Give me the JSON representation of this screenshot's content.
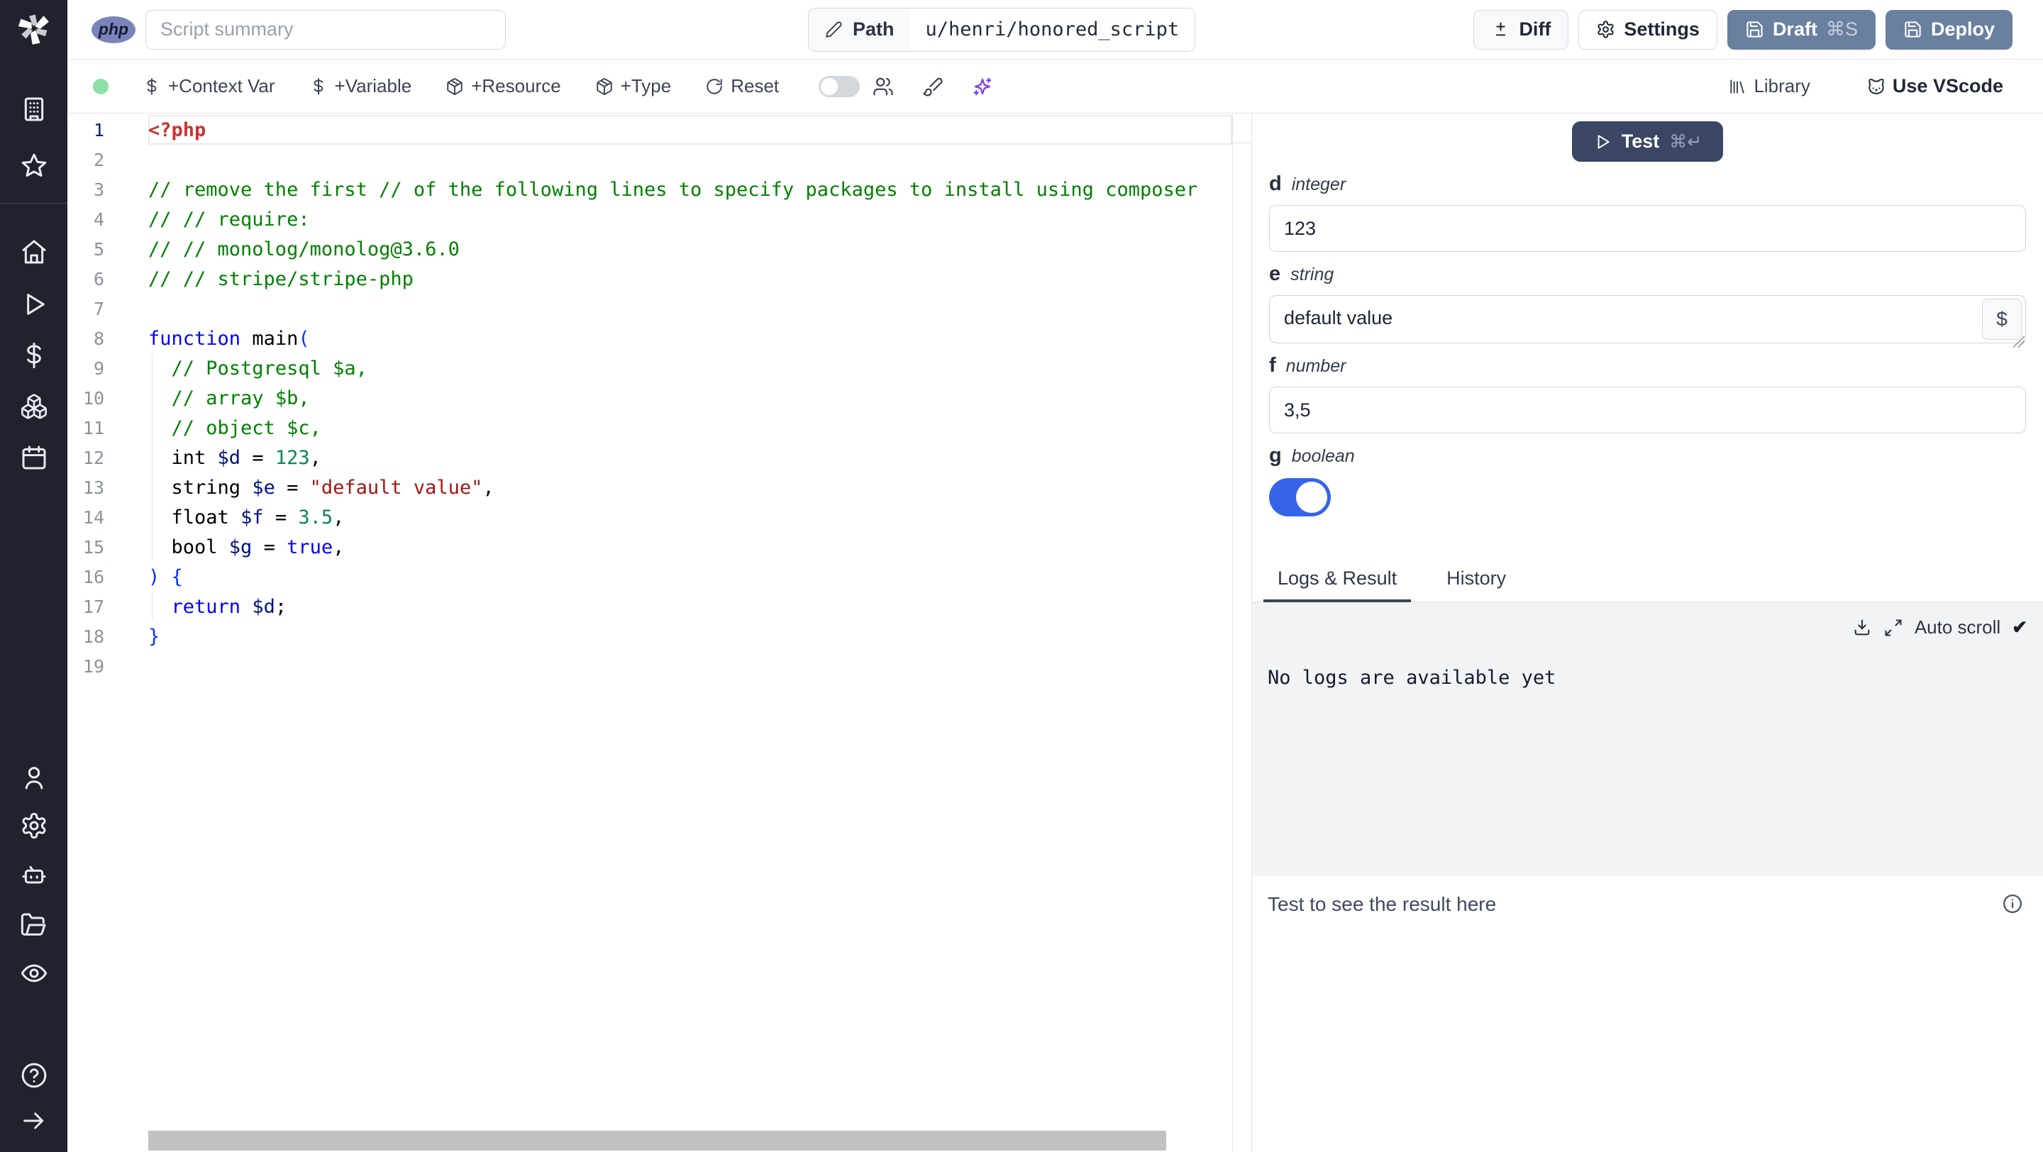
{
  "topbar": {
    "lang_badge": "php",
    "summary_placeholder": "Script summary",
    "path_label": "Path",
    "path_value": "u/henri/honored_script",
    "diff_label": "Diff",
    "settings_label": "Settings",
    "draft_label": "Draft",
    "draft_shortcut": "⌘S",
    "deploy_label": "Deploy"
  },
  "toolbar": {
    "add_context_var": "+Context Var",
    "add_variable": "+Variable",
    "add_resource": "+Resource",
    "add_type": "+Type",
    "reset_label": "Reset",
    "library_label": "Library",
    "vscode_label": "Use VScode"
  },
  "icons": {
    "windmill-logo-icon": "white pinwheel",
    "pencil-icon": "✎",
    "diff-icon": "±",
    "gear-icon": "⚙",
    "save-icon": "💾",
    "dollar-icon": "$",
    "package-icon": "box",
    "reset-icon": "↻",
    "users-icon": "people",
    "brush-icon": "paintbrush",
    "sparkles-icon": "✦ ai",
    "library-icon": "|||\\",
    "cat-icon": "vscode cat",
    "play-icon": "▷",
    "download-icon": "⤓",
    "expand-icon": "⤢",
    "check-icon": "✔",
    "info-icon": "ⓘ"
  },
  "sidebar": {
    "icons": [
      "windmill-logo",
      "building",
      "star",
      "home",
      "play",
      "dollar-sign",
      "boxes",
      "calendar",
      "user",
      "settings-gear",
      "bot",
      "folder-open",
      "eye",
      "help-circle",
      "arrow-right"
    ]
  },
  "editor": {
    "language": "php",
    "lines": [
      {
        "n": 1,
        "active": true,
        "tokens": [
          [
            "<?php",
            "tag"
          ]
        ]
      },
      {
        "n": 2,
        "tokens": []
      },
      {
        "n": 3,
        "tokens": [
          [
            "// remove the first // of the following lines to specify packages to install using composer",
            "comment"
          ]
        ]
      },
      {
        "n": 4,
        "tokens": [
          [
            "// // require:",
            "comment"
          ]
        ]
      },
      {
        "n": 5,
        "tokens": [
          [
            "// // monolog/monolog@3.6.0",
            "comment"
          ]
        ]
      },
      {
        "n": 6,
        "tokens": [
          [
            "// // stripe/stripe-php",
            "comment"
          ]
        ]
      },
      {
        "n": 7,
        "tokens": []
      },
      {
        "n": 8,
        "tokens": [
          [
            "function",
            "keyword"
          ],
          [
            " ",
            "plain"
          ],
          [
            "main",
            "plain"
          ],
          [
            "(",
            "bracket"
          ]
        ]
      },
      {
        "n": 9,
        "indent": 1,
        "tokens": [
          [
            "  ",
            "plain"
          ],
          [
            "// Postgresql $a,",
            "comment"
          ]
        ]
      },
      {
        "n": 10,
        "indent": 1,
        "tokens": [
          [
            "  ",
            "plain"
          ],
          [
            "// array $b,",
            "comment"
          ]
        ]
      },
      {
        "n": 11,
        "indent": 1,
        "tokens": [
          [
            "  ",
            "plain"
          ],
          [
            "// object $c,",
            "comment"
          ]
        ]
      },
      {
        "n": 12,
        "indent": 1,
        "tokens": [
          [
            "  ",
            "plain"
          ],
          [
            "int ",
            "plain"
          ],
          [
            "$d",
            "variable"
          ],
          [
            " = ",
            "plain"
          ],
          [
            "123",
            "number"
          ],
          [
            ",",
            "plain"
          ]
        ]
      },
      {
        "n": 13,
        "indent": 1,
        "tokens": [
          [
            "  ",
            "plain"
          ],
          [
            "string ",
            "plain"
          ],
          [
            "$e",
            "variable"
          ],
          [
            " = ",
            "plain"
          ],
          [
            "\"default value\"",
            "string"
          ],
          [
            ",",
            "plain"
          ]
        ]
      },
      {
        "n": 14,
        "indent": 1,
        "tokens": [
          [
            "  ",
            "plain"
          ],
          [
            "float ",
            "plain"
          ],
          [
            "$f",
            "variable"
          ],
          [
            " = ",
            "plain"
          ],
          [
            "3.5",
            "number"
          ],
          [
            ",",
            "plain"
          ]
        ]
      },
      {
        "n": 15,
        "indent": 1,
        "tokens": [
          [
            "  ",
            "plain"
          ],
          [
            "bool ",
            "plain"
          ],
          [
            "$g",
            "variable"
          ],
          [
            " = ",
            "plain"
          ],
          [
            "true",
            "keyword"
          ],
          [
            ",",
            "plain"
          ]
        ]
      },
      {
        "n": 16,
        "tokens": [
          [
            ") {",
            "bracket"
          ]
        ]
      },
      {
        "n": 17,
        "indent": 1,
        "tokens": [
          [
            "  ",
            "plain"
          ],
          [
            "return",
            "keyword"
          ],
          [
            " ",
            "plain"
          ],
          [
            "$d",
            "variable"
          ],
          [
            ";",
            "plain"
          ]
        ]
      },
      {
        "n": 18,
        "tokens": [
          [
            "}",
            "bracket"
          ]
        ]
      },
      {
        "n": 19,
        "tokens": []
      }
    ]
  },
  "panel": {
    "test_label": "Test",
    "test_shortcut": "⌘↵",
    "dollar_button_label": "$",
    "fields": [
      {
        "name": "d",
        "type": "integer",
        "widget": "text",
        "value": "123"
      },
      {
        "name": "e",
        "type": "string",
        "widget": "textarea",
        "value": "default value"
      },
      {
        "name": "f",
        "type": "number",
        "widget": "text",
        "value": "3,5"
      },
      {
        "name": "g",
        "type": "boolean",
        "widget": "toggle",
        "value": true
      }
    ],
    "tabs": [
      {
        "label": "Logs & Result",
        "active": true
      },
      {
        "label": "History",
        "active": false
      }
    ],
    "autoscroll_label": "Auto scroll",
    "autoscroll_check": "✔",
    "logs_empty": "No logs are available yet",
    "result_placeholder": "Test to see the result here"
  },
  "colors": {
    "sidebar_bg": "#1e232d",
    "primary_button": "#69809f",
    "test_button": "#3a4663",
    "toggle_on": "#3664e9",
    "status_dot": "#8ce0a5",
    "php_badge": "#7b84ba",
    "ai_purple": "#7c3aed",
    "logs_bg": "#f1f3f5",
    "code_comment": "#008000",
    "code_keyword": "#0000ff",
    "code_variable": "#001080",
    "code_number": "#098658",
    "code_string": "#a31515",
    "code_tag": "#cd3131"
  }
}
